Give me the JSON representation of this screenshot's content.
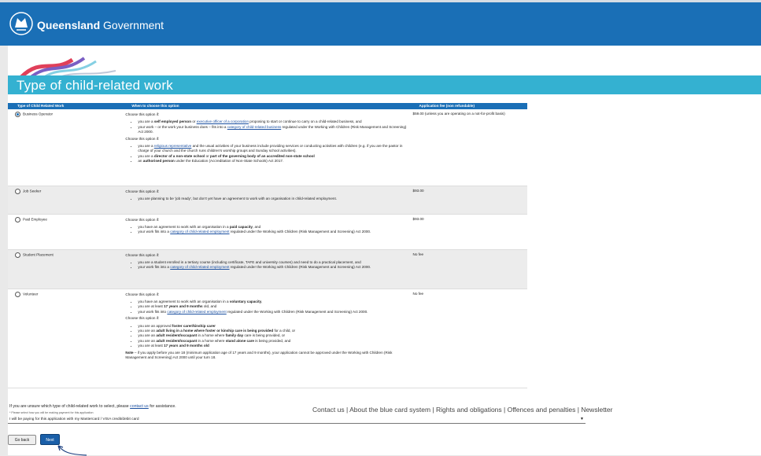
{
  "header": {
    "brand_bold": "Queensland",
    "brand_rest": "Government",
    "logo_icon": "qld-crest-icon"
  },
  "banner": {
    "title": "Type of child-related work"
  },
  "table": {
    "headers": [
      "Type of Child Related Work",
      "When to choose this option",
      "Application fee (non refundable)"
    ],
    "rows": [
      {
        "label": "Business Operator",
        "selected": true,
        "fee": "$59.00 (unless you are operating on a not-for-profit basis)",
        "p1": "Choose this option if:",
        "b1a_pre": "you are a ",
        "b1a_bold": "self employed person",
        "b1a_mid": " or ",
        "b1a_link": "executive officer of a corporation",
        "b1a_post": " proposing to start or continue to carry on a child-related business, and",
        "b1b_pre": "your work – or the work your business does – fits into a ",
        "b1b_link": "category of child-related business",
        "b1b_post": " regulated under the Working with Children (Risk Management and Screening) Act 2000.",
        "p2": "Choose this option if:",
        "b2a_pre": "you are a ",
        "b2a_link": "religious representative",
        "b2a_post": " and the usual activities of your business include providing services or conducting activities with children (e.g. if you are the pastor in charge of your church and the church runs children's worship groups and Sunday school activities).",
        "b2b_pre": "you are a ",
        "b2b_bold": "director of a non-state school",
        "b2b_mid": " or ",
        "b2b_bold2": "part of the governing body of an accredited non-state school",
        "b2c_pre": "an ",
        "b2c_bold": "authorised person",
        "b2c_post": " under the Education (Accreditation of Non-State Schools) Act 2017."
      },
      {
        "label": "Job Seeker",
        "selected": false,
        "fee": "$93.00",
        "p1": "Choose this option if:",
        "b1": "you are planning to be 'job ready', but don't yet have an agreement to work with an organisation in child-related employment."
      },
      {
        "label": "Paid Employee",
        "selected": false,
        "fee": "$93.00",
        "p1": "Choose this option if:",
        "b1_pre": "you have an agreement to work with an organisation in a ",
        "b1_bold": "paid capacity",
        "b1_post": ", and",
        "b2_pre": "your work fits into a ",
        "b2_link": "category of child-related employment",
        "b2_post": " regulated under the Working with Children (Risk Management and Screening) Act 2000."
      },
      {
        "label": "Student Placement",
        "selected": false,
        "fee": "No fee",
        "p1": "Choose this option if:",
        "b1": "you are a student enrolled in a tertiary course (including certificate, TAFE and university courses) and need to do a practical placement, and",
        "b2_pre": "your work fits into a ",
        "b2_link": "category of child-related employment",
        "b2_post": " regulated under the Working with Children (Risk Management and Screening) Act 2000."
      },
      {
        "label": "Volunteer",
        "selected": false,
        "fee": "No fee",
        "p1": "Choose this option if:",
        "b1_pre": "you have an agreement to work with an organisation in a ",
        "b1_bold": "voluntary capacity",
        "b1_post": ",",
        "b2_pre": "you are at least ",
        "b2_bold": "17 years and 9 months",
        "b2_post": " old, and",
        "b3_pre": "your work fits into ",
        "b3_link": "category of child-related employment",
        "b3_post": " regulated under the Working with Children (Risk Management and Screening) Act 2000.",
        "p2": "Choose this option if:",
        "c1_pre": "you are an approved ",
        "c1_bold": "foster carer/kinship carer",
        "c2_pre": "you are an ",
        "c2_bold": "adult living in a home where foster or kinship care is being provided",
        "c2_post": " for a child, or",
        "c3_pre": "you are an ",
        "c3_bold": "adult resident/occupant",
        "c3_mid": " in a home where ",
        "c3_bold2": "family day",
        "c3_post": " care is being provided, or",
        "c4_pre": "you are an ",
        "c4_bold": "adult resident/occupant",
        "c4_mid": " in a home where ",
        "c4_bold2": "stand alone care",
        "c4_post": " is being provided, and",
        "c5_pre": "you are at least ",
        "c5_bold": "17 years and 9 months old",
        "note_bold": "Note",
        "note_text": " – if you apply before you are 18 (minimum application age of 17 years and 9 months), your application cannot be approved under the Working with Children (Risk Management and Screening) Act 2000 until your turn 18."
      }
    ]
  },
  "form": {
    "unsure_pre": "If you are unsure which type of child-related work to select, please ",
    "unsure_link": "contact us",
    "unsure_post": " for assistance.",
    "payment_hint": "* Please select how you will be making payment for this application",
    "payment_value": "I will be paying for this application with my Mastercard / VISA credit/debit card",
    "back_label": "Go back",
    "next_label": "Next"
  },
  "footer": {
    "links": "Contact us | About the blue card system | Rights and obligations | Offences and penalties | Newsletter"
  },
  "colors": {
    "brand_blue": "#1a6fb6",
    "banner_cyan": "#34b1d1"
  }
}
